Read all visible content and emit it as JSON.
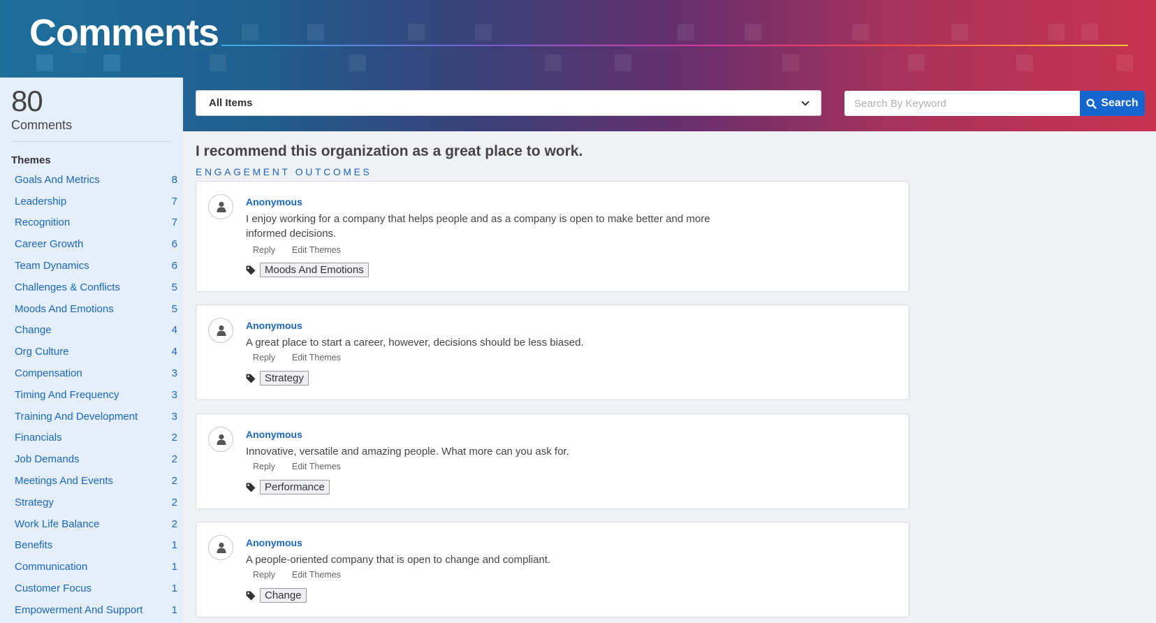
{
  "header": {
    "title": "Comments"
  },
  "summary": {
    "count": "80",
    "label": "Comments"
  },
  "themes": {
    "heading": "Themes",
    "items": [
      {
        "label": "Goals And Metrics",
        "count": "8"
      },
      {
        "label": "Leadership",
        "count": "7"
      },
      {
        "label": "Recognition",
        "count": "7"
      },
      {
        "label": "Career Growth",
        "count": "6"
      },
      {
        "label": "Team Dynamics",
        "count": "6"
      },
      {
        "label": "Challenges & Conflicts",
        "count": "5"
      },
      {
        "label": "Moods And Emotions",
        "count": "5"
      },
      {
        "label": "Change",
        "count": "4"
      },
      {
        "label": "Org Culture",
        "count": "4"
      },
      {
        "label": "Compensation",
        "count": "3"
      },
      {
        "label": "Timing And Frequency",
        "count": "3"
      },
      {
        "label": "Training And Development",
        "count": "3"
      },
      {
        "label": "Financials",
        "count": "2"
      },
      {
        "label": "Job Demands",
        "count": "2"
      },
      {
        "label": "Meetings And Events",
        "count": "2"
      },
      {
        "label": "Strategy",
        "count": "2"
      },
      {
        "label": "Work Life Balance",
        "count": "2"
      },
      {
        "label": "Benefits",
        "count": "1"
      },
      {
        "label": "Communication",
        "count": "1"
      },
      {
        "label": "Customer Focus",
        "count": "1"
      },
      {
        "label": "Empowerment And Support",
        "count": "1"
      }
    ]
  },
  "filter": {
    "selected": "All Items"
  },
  "search": {
    "placeholder": "Search By Keyword",
    "button_label": "Search"
  },
  "question": {
    "text": "I recommend this organization as a great place to work.",
    "category": "ENGAGEMENT OUTCOMES"
  },
  "comments": [
    {
      "author": "Anonymous",
      "text": "I enjoy working for a company that helps people and as a company is open to make better and more informed decisions.",
      "reply_label": "Reply",
      "edit_label": "Edit Themes",
      "tag": "Moods And Emotions"
    },
    {
      "author": "Anonymous",
      "text": "A great place to start a career, however, decisions should be less biased.",
      "reply_label": "Reply",
      "edit_label": "Edit Themes",
      "tag": "Strategy"
    },
    {
      "author": "Anonymous",
      "text": "Innovative, versatile and amazing people. What more can you ask for.",
      "reply_label": "Reply",
      "edit_label": "Edit Themes",
      "tag": "Performance"
    },
    {
      "author": "Anonymous",
      "text": "A people-oriented company that is open to change and compliant.",
      "reply_label": "Reply",
      "edit_label": "Edit Themes",
      "tag": "Change"
    }
  ],
  "colors": {
    "accent": "#1566cc",
    "link": "#1a66c0",
    "sidebar_bg": "#e4effb",
    "page_bg": "#f0f1f5"
  },
  "icons": {
    "avatar": "user-icon",
    "tag": "tag-icon",
    "search": "search-icon",
    "select": "chevron-down-icon"
  }
}
